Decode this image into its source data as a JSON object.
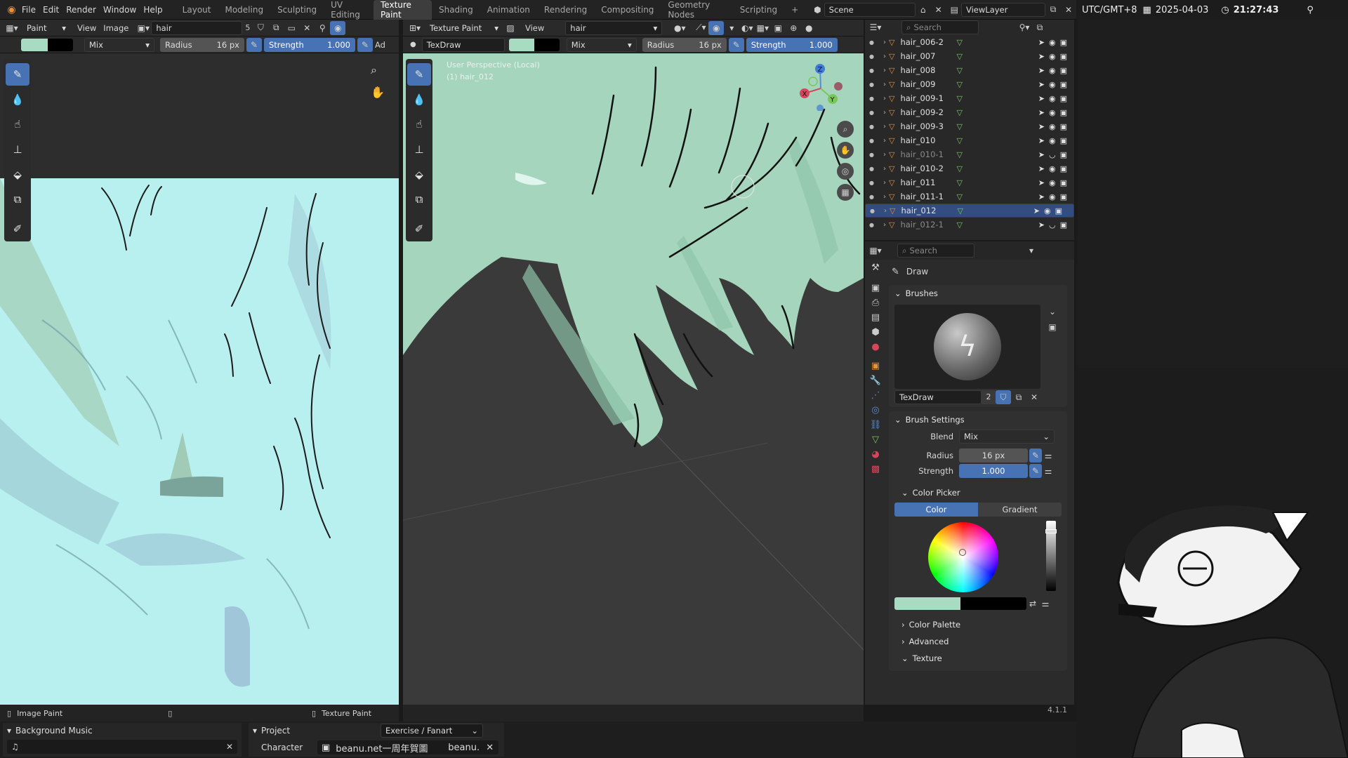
{
  "menu": {
    "file": "File",
    "edit": "Edit",
    "render": "Render",
    "window": "Window",
    "help": "Help"
  },
  "workspaces": [
    "Layout",
    "Modeling",
    "Sculpting",
    "UV Editing",
    "Texture Paint",
    "Shading",
    "Animation",
    "Rendering",
    "Compositing",
    "Geometry Nodes",
    "Scripting"
  ],
  "active_workspace": "Texture Paint",
  "scene": "Scene",
  "view_layer": "ViewLayer",
  "clock": {
    "tz": "UTC/GMT+8",
    "date": "2025-04-03",
    "time": "21:27:43"
  },
  "image_editor": {
    "mode": "Paint",
    "view": "View",
    "image": "Image",
    "image_name": "hair",
    "users": "5",
    "blend": "Mix",
    "radius_label": "Radius",
    "radius_val": "16 px",
    "strength_label": "Strength",
    "strength_val": "1.000",
    "adv": "Ad",
    "status": "Image Paint"
  },
  "viewport": {
    "mode": "Texture Paint",
    "view": "View",
    "material": "hair",
    "brush": "TexDraw",
    "blend": "Mix",
    "radius_label": "Radius",
    "radius_val": "16 px",
    "strength_label": "Strength",
    "strength_val": "1.000",
    "overlay_line1": "User Perspective (Local)",
    "overlay_line2": "(1) hair_012",
    "status": "Texture Paint",
    "axes": {
      "x": "X",
      "y": "Y",
      "z": "Z"
    }
  },
  "outliner": {
    "search": "Search",
    "rows": [
      {
        "name": "hair_006-2",
        "dim": false,
        "sel": false
      },
      {
        "name": "hair_007",
        "dim": false,
        "sel": false
      },
      {
        "name": "hair_008",
        "dim": false,
        "sel": false
      },
      {
        "name": "hair_009",
        "dim": false,
        "sel": false
      },
      {
        "name": "hair_009-1",
        "dim": false,
        "sel": false
      },
      {
        "name": "hair_009-2",
        "dim": false,
        "sel": false
      },
      {
        "name": "hair_009-3",
        "dim": false,
        "sel": false
      },
      {
        "name": "hair_010",
        "dim": false,
        "sel": false
      },
      {
        "name": "hair_010-1",
        "dim": true,
        "sel": false
      },
      {
        "name": "hair_010-2",
        "dim": false,
        "sel": false
      },
      {
        "name": "hair_011",
        "dim": false,
        "sel": false
      },
      {
        "name": "hair_011-1",
        "dim": false,
        "sel": false
      },
      {
        "name": "hair_012",
        "dim": false,
        "sel": true
      },
      {
        "name": "hair_012-1",
        "dim": true,
        "sel": false
      }
    ]
  },
  "properties": {
    "search": "Search",
    "tool_title": "Draw",
    "brushes": "Brushes",
    "brush_name": "TexDraw",
    "brush_users": "2",
    "brush_settings": "Brush Settings",
    "blend_label": "Blend",
    "blend_val": "Mix",
    "radius_label": "Radius",
    "radius_val": "16 px",
    "strength_label": "Strength",
    "strength_val": "1.000",
    "color_picker": "Color Picker",
    "color_tab": "Color",
    "gradient_tab": "Gradient",
    "color_palette": "Color Palette",
    "advanced": "Advanced",
    "texture": "Texture",
    "version": "4.1.1"
  },
  "colors": {
    "primary": "#a8dcc2",
    "secondary": "#000000",
    "accent": "#4772b3",
    "image_bg": "#b8f0ef",
    "hair": "#a5d6bd"
  },
  "bottom": {
    "music_title": "Background Music",
    "project_title": "Project",
    "project_val": "Exercise / Fanart",
    "character_label": "Character",
    "character_val": "beanu.net一周年賀圖",
    "character_tail": "beanu."
  }
}
